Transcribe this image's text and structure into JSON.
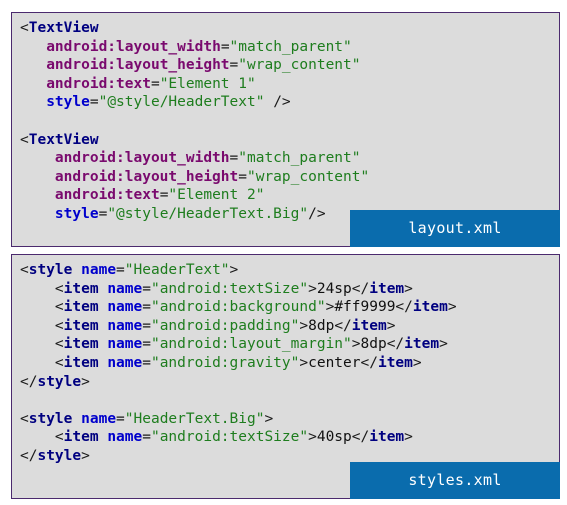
{
  "colors": {
    "panel_bg": "#dcdcdc",
    "panel_border": "#4b2a6e",
    "label_bg": "#0a6cad",
    "label_text": "#ffffff",
    "tag_name": "#000080",
    "attribute": "#7a0a6e",
    "style_attribute": "#0000cc",
    "value": "#1e7d1e"
  },
  "layout_panel": {
    "file_label": "layout.xml",
    "lines": {
      "l1_open": "<",
      "l1_tag": "TextView",
      "l2_indent": "   ",
      "l2_attr": "android:layout_width",
      "l2_eq": "=",
      "l2_val": "\"match_parent\"",
      "l3_indent": "   ",
      "l3_attr": "android:layout_height",
      "l3_eq": "=",
      "l3_val": "\"wrap_content\"",
      "l4_indent": "   ",
      "l4_attr": "android:text",
      "l4_eq": "=",
      "l4_val": "\"Element 1\"",
      "l5_indent": "   ",
      "l5_attr": "style",
      "l5_eq": "=",
      "l5_val": "\"@style/HeaderText\"",
      "l5_close": " />",
      "l7_open": "<",
      "l7_tag": "TextView",
      "l8_indent": "    ",
      "l8_attr": "android:layout_width",
      "l8_eq": "=",
      "l8_val": "\"match_parent\"",
      "l9_indent": "    ",
      "l9_attr": "android:layout_height",
      "l9_eq": "=",
      "l9_val": "\"wrap_content\"",
      "l10_indent": "    ",
      "l10_attr": "android:text",
      "l10_eq": "=",
      "l10_val": "\"Element 2\"",
      "l11_indent": "    ",
      "l11_attr": "style",
      "l11_eq": "=",
      "l11_val": "\"@style/HeaderText.Big\"",
      "l11_close": "/>"
    }
  },
  "styles_panel": {
    "file_label": "styles.xml",
    "lines": {
      "s1_open": "<",
      "s1_tag": "style",
      "s1_sp": " ",
      "s1_attr": "name",
      "s1_eq": "=",
      "s1_val": "\"HeaderText\"",
      "s1_close": ">",
      "item_indent": "    ",
      "item_open": "<",
      "item_tag": "item",
      "item_sp": " ",
      "item_attr": "name",
      "item_eq": "=",
      "item_gt": ">",
      "item_close_open": "</",
      "item_close_gt": ">",
      "i1_val": "\"android:textSize\"",
      "i1_text": "24sp",
      "i2_val": "\"android:background\"",
      "i2_text": "#ff9999",
      "i3_val": "\"android:padding\"",
      "i3_text": "8dp",
      "i4_val": "\"android:layout_margin\"",
      "i4_text": "8dp",
      "i5_val": "\"android:gravity\"",
      "i5_text": "center",
      "s7_close_open": "</",
      "s7_tag": "style",
      "s7_gt": ">",
      "s9_val": "\"HeaderText.Big\"",
      "i6_val": "\"android:textSize\"",
      "i6_text": "40sp"
    }
  }
}
